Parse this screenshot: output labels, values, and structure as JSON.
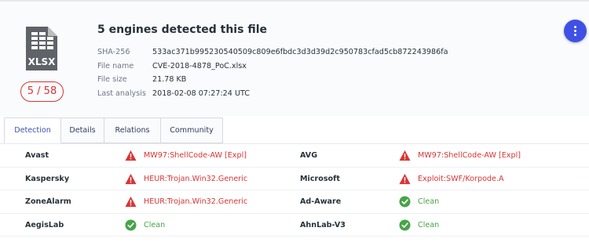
{
  "file": {
    "icon_label": "XLSX",
    "score": "5 / 58",
    "title": "5 engines detected this file",
    "details": [
      {
        "key": "SHA-256",
        "value": "533ac371b995230540509c809e6fbdc3d3d39d2c950783cfad5cb872243986fa"
      },
      {
        "key": "File name",
        "value": "CVE-2018-4878_PoC.xlsx"
      },
      {
        "key": "File size",
        "value": "21.78 KB"
      },
      {
        "key": "Last analysis",
        "value": "2018-02-08 07:27:24 UTC"
      }
    ]
  },
  "tabs": [
    "Detection",
    "Details",
    "Relations",
    "Community"
  ],
  "active_tab": "Detection",
  "colors": {
    "malicious": "#d83434",
    "clean": "#47a447",
    "accent": "#3f51e4"
  },
  "results": [
    [
      {
        "engine": "Avast",
        "status": "malicious",
        "result": "MW97:ShellCode-AW [Expl]"
      },
      {
        "engine": "AVG",
        "status": "malicious",
        "result": "MW97:ShellCode-AW [Expl]"
      }
    ],
    [
      {
        "engine": "Kaspersky",
        "status": "malicious",
        "result": "HEUR:Trojan.Win32.Generic"
      },
      {
        "engine": "Microsoft",
        "status": "malicious",
        "result": "Exploit:SWF/Korpode.A"
      }
    ],
    [
      {
        "engine": "ZoneAlarm",
        "status": "malicious",
        "result": "HEUR:Trojan.Win32.Generic"
      },
      {
        "engine": "Ad-Aware",
        "status": "clean",
        "result": "Clean"
      }
    ],
    [
      {
        "engine": "AegisLab",
        "status": "clean",
        "result": "Clean"
      },
      {
        "engine": "AhnLab-V3",
        "status": "clean",
        "result": "Clean"
      }
    ]
  ]
}
